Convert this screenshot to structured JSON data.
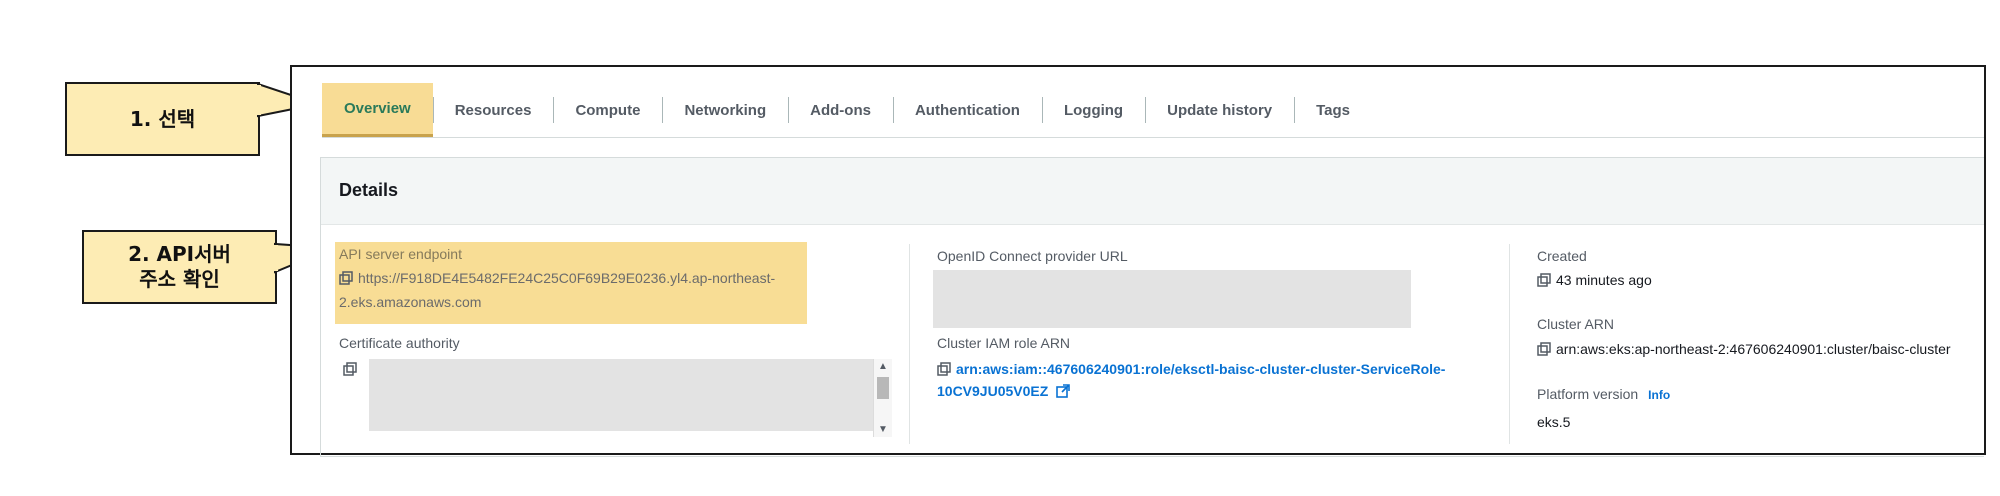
{
  "callouts": {
    "step1": "1. 선택",
    "step2_line1": "2. API서버",
    "step2_line2": "주소 확인"
  },
  "tabs": [
    "Overview",
    "Resources",
    "Compute",
    "Networking",
    "Add-ons",
    "Authentication",
    "Logging",
    "Update history",
    "Tags"
  ],
  "active_tab": "Overview",
  "details": {
    "title": "Details",
    "api_endpoint_label": "API server endpoint",
    "api_endpoint_line1": "https://F918DE4E5482FE24C25C0F69B29E0236.yl4.ap-northeast-",
    "api_endpoint_line2": "2.eks.amazonaws.com",
    "certificate_label": "Certificate authority",
    "oidc_label": "OpenID Connect provider URL",
    "iam_role_label": "Cluster IAM role ARN",
    "iam_role_line1": "arn:aws:iam::467606240901:role/eksctl-baisc-cluster-cluster-ServiceRole-",
    "iam_role_line2": "10CV9JU05V0EZ",
    "created_label": "Created",
    "created_value": "43 minutes ago",
    "arn_label": "Cluster ARN",
    "arn_value": "arn:aws:eks:ap-northeast-2:467606240901:cluster/baisc-cluster",
    "platform_label": "Platform version",
    "platform_info": "Info",
    "platform_value": "eks.5"
  },
  "colors": {
    "highlight": "#f7d783",
    "callout_fill": "#fdecb4",
    "link": "#0972d3"
  }
}
